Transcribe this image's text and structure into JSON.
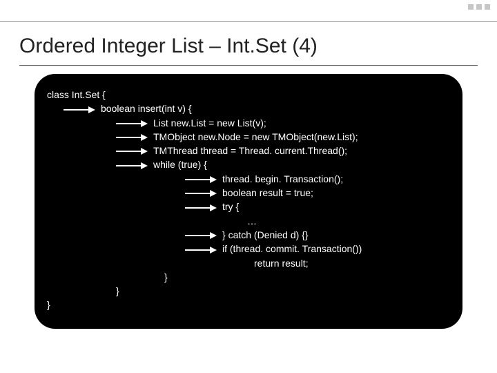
{
  "slide": {
    "title": "Ordered Integer List – Int.Set (4)"
  },
  "code": {
    "l0": "class Int.Set {",
    "l1": "boolean insert(int v) {",
    "l2": "List new.List = new List(v);",
    "l3": "TMObject new.Node = new TMObject(new.List);",
    "l4": "TMThread thread = Thread. current.Thread();",
    "l5": "while (true) {",
    "l6": "thread. begin. Transaction();",
    "l7": "boolean result = true;",
    "l8": "try {",
    "l9": "…",
    "l10": "} catch (Denied d) {}",
    "l11": "if (thread. commit. Transaction())",
    "l12": "return result;",
    "l13": "}",
    "l14": "}",
    "l15": "}"
  }
}
